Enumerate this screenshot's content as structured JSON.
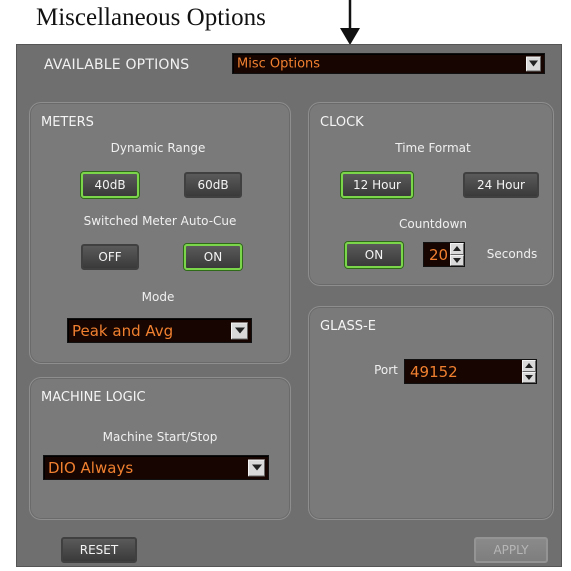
{
  "caption": "Miscellaneous Options",
  "available_options": {
    "label": "AVAILABLE OPTIONS",
    "selected": "Misc Options"
  },
  "meters": {
    "title": "METERS",
    "dynamic_range": {
      "label": "Dynamic Range",
      "options": [
        "40dB",
        "60dB"
      ],
      "selected": "40dB"
    },
    "auto_cue": {
      "label": "Switched Meter Auto-Cue",
      "options": [
        "OFF",
        "ON"
      ],
      "selected": "ON"
    },
    "mode": {
      "label": "Mode",
      "selected": "Peak and Avg"
    }
  },
  "clock": {
    "title": "CLOCK",
    "time_format": {
      "label": "Time Format",
      "options": [
        "12 Hour",
        "24 Hour"
      ],
      "selected": "12 Hour"
    },
    "countdown": {
      "label": "Countdown",
      "toggle": "ON",
      "value": "20",
      "unit": "Seconds"
    }
  },
  "machine_logic": {
    "title": "MACHINE LOGIC",
    "start_stop": {
      "label": "Machine Start/Stop",
      "selected": "DIO Always"
    }
  },
  "glass_e": {
    "title": "GLASS-E",
    "port": {
      "label": "Port",
      "value": "49152"
    }
  },
  "footer": {
    "reset_label": "RESET",
    "apply_label": "APPLY"
  },
  "colors": {
    "selected_outline": "#7cd64a",
    "field_background": "#160500",
    "field_text": "#f08030",
    "panel_background": "#7a7a7a",
    "window_background": "#6f6f6f"
  },
  "icons": {
    "dropdown": "chevron-down-icon",
    "spin_up": "triangle-up-icon",
    "spin_down": "triangle-down-icon",
    "caption_arrow": "arrow-down-icon"
  }
}
